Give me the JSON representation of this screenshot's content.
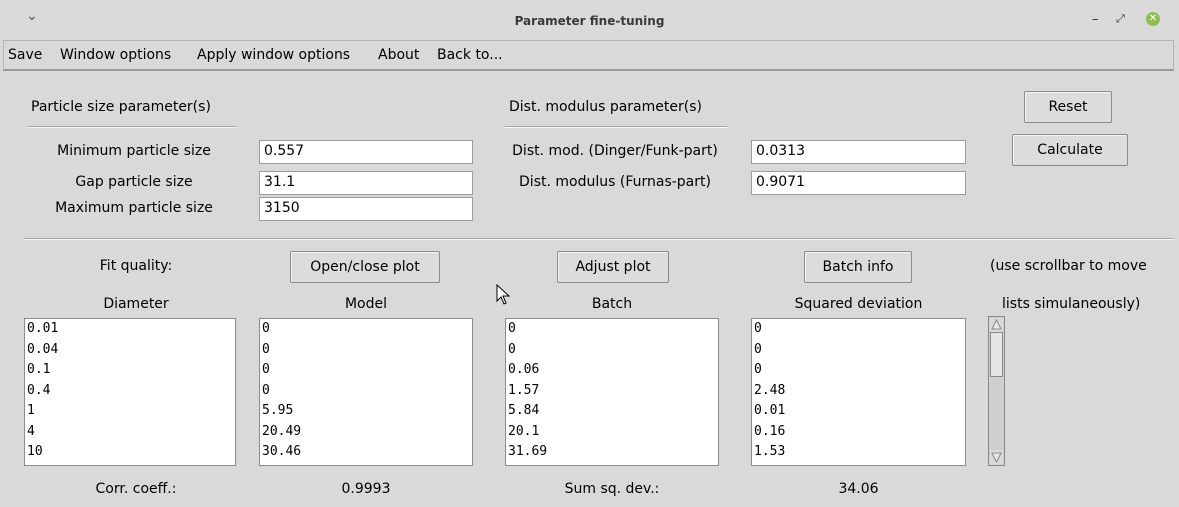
{
  "window": {
    "title": "Parameter fine-tuning",
    "controls": {
      "minimize": "–",
      "maximize": "⤢",
      "close": "✕"
    },
    "chevron": "⌄"
  },
  "menu": [
    "Save",
    "Window options",
    "Apply window options",
    "About",
    "Back to..."
  ],
  "particle": {
    "heading": "Particle size parameter(s)",
    "fields": [
      {
        "label": "Minimum particle size",
        "value": "0.557"
      },
      {
        "label": "Gap particle size",
        "value": "31.1"
      },
      {
        "label": "Maximum particle size",
        "value": "3150"
      }
    ]
  },
  "distmod": {
    "heading": "Dist. modulus parameter(s)",
    "fields": [
      {
        "label": "Dist. mod. (Dinger/Funk-part)",
        "value": "0.0313"
      },
      {
        "label": "Dist. modulus (Furnas-part)",
        "value": "0.9071"
      }
    ]
  },
  "buttons": {
    "reset": "Reset",
    "calculate": "Calculate",
    "open_close_plot": "Open/close plot",
    "adjust_plot": "Adjust plot",
    "batch_info": "Batch info"
  },
  "fit": {
    "label": "Fit quality:",
    "scroll_hint_line1": "(use scrollbar to move",
    "scroll_hint_line2": "lists simulaneously)"
  },
  "columns": {
    "headers": [
      "Diameter",
      "Model",
      "Batch",
      "Squared deviation"
    ],
    "diameter": [
      "0.01",
      "0.04",
      "0.1",
      "0.4",
      "1",
      "4",
      "10"
    ],
    "model": [
      "0",
      "0",
      "0",
      "0",
      "5.95",
      "20.49",
      "30.46"
    ],
    "batch": [
      "0",
      "0",
      "0.06",
      "1.57",
      "5.84",
      "20.1",
      "31.69"
    ],
    "sqdev": [
      "0",
      "0",
      "0",
      "2.48",
      "0.01",
      "0.16",
      "1.53"
    ]
  },
  "summary": {
    "corr_label": "Corr. coeff.:",
    "corr_value": "0.9993",
    "sumsq_label": "Sum sq. dev.:",
    "sumsq_value": "34.06"
  }
}
